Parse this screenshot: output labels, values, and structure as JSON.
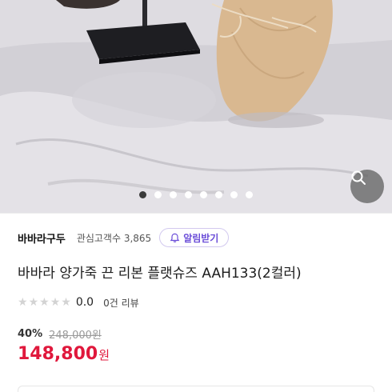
{
  "gallery": {
    "slide_count": 8,
    "active_index": 0,
    "zoom_icon": "search-icon"
  },
  "shop": {
    "name": "바바라구두",
    "followers": "관심고객수 3,865",
    "alarm_label": "알림받기",
    "alarm_icon": "bell-icon"
  },
  "product": {
    "title": "바바라 양가죽 끈 리본 플랫슈즈 AAH133(2컬러)",
    "rating": {
      "stars_filled": 0,
      "value": "0.0",
      "reviews": "0건 리뷰"
    },
    "discount_rate": "40%",
    "original_price": "248,000원",
    "sale_price": "148,800",
    "currency": "원"
  },
  "colors": {
    "accent": "#6a4cd8",
    "price": "#e0183c",
    "star_empty": "#d3d3d3"
  }
}
